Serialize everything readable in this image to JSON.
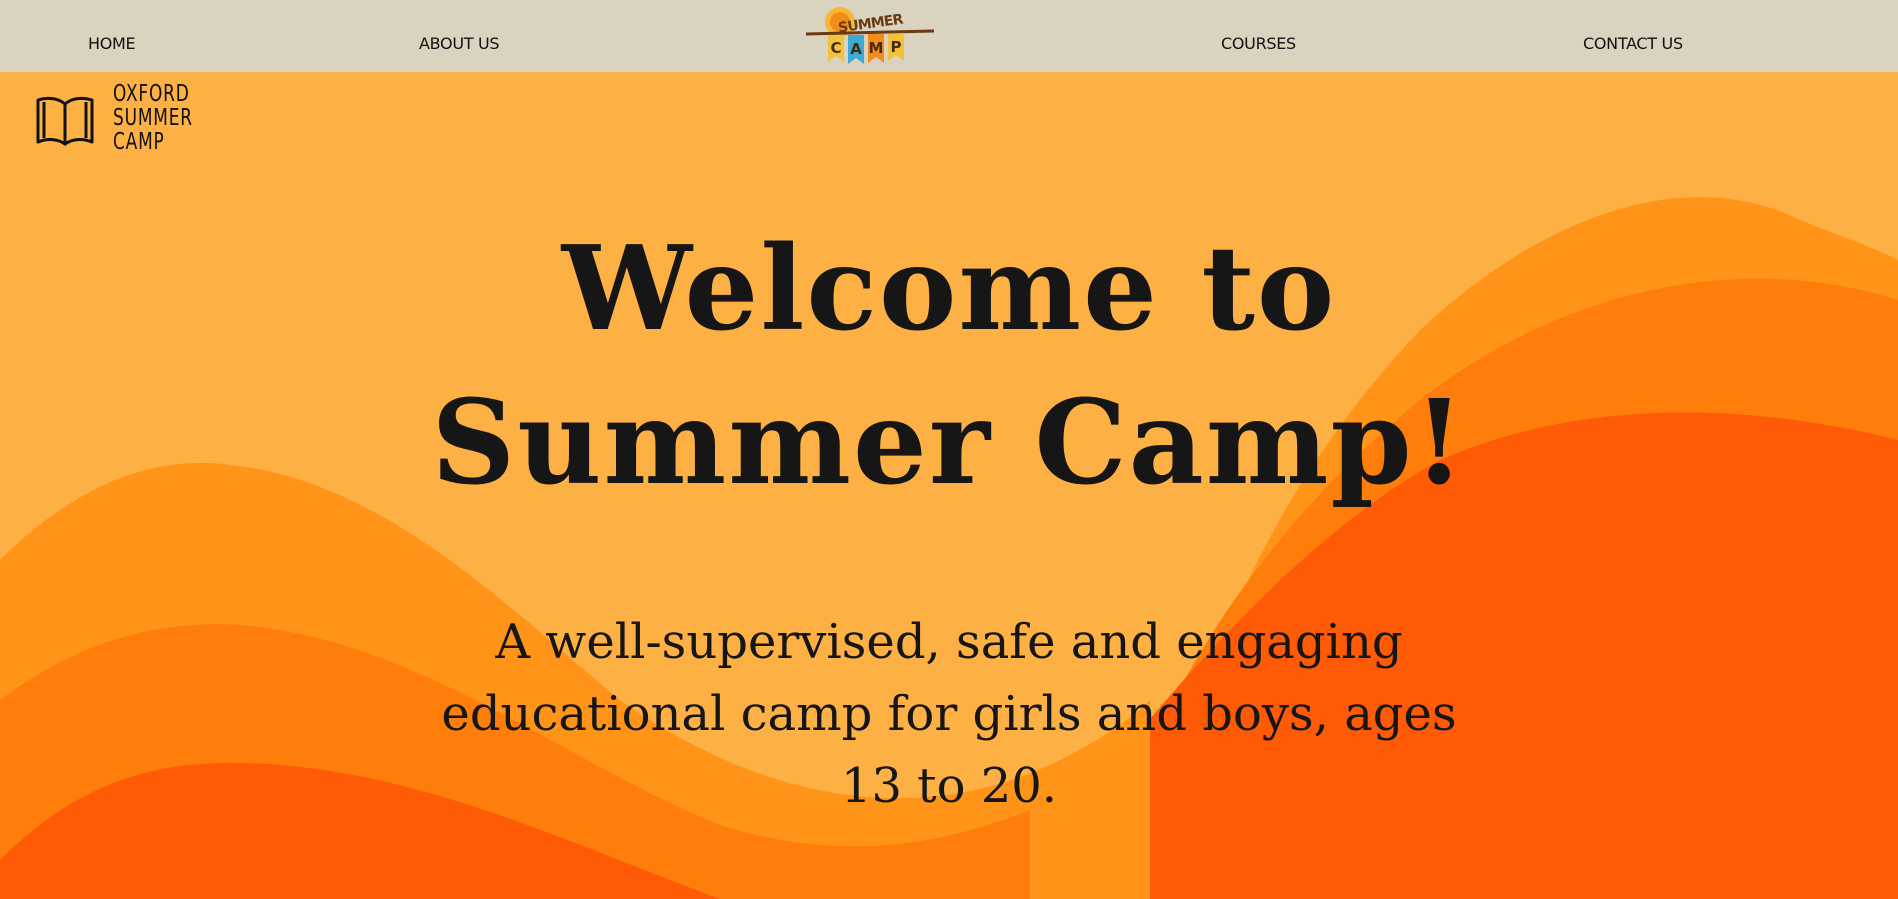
{
  "nav": {
    "home": "HOME",
    "about": "ABOUT US",
    "courses": "COURSES",
    "contact": "CONTACT US"
  },
  "logo": {
    "top_text": "SUMMER",
    "letters": [
      "C",
      "A",
      "M",
      "P"
    ],
    "icon": "summer-camp-banner-logo"
  },
  "brand": {
    "name": "OXFORD\nSUMMER\nCAMP",
    "icon": "open-book-icon"
  },
  "hero": {
    "title": "Welcome to Summer Camp!",
    "subtitle": "A well-supervised, safe and engaging educational camp for girls and boys, ages 13 to 20."
  },
  "colors": {
    "background": "#FDB043",
    "nav_bar": "#D9D3C0",
    "wave_light": "#FF9418",
    "wave_mid": "#FF7D0A",
    "wave_dark": "#FF5A05",
    "text": "#161616"
  }
}
